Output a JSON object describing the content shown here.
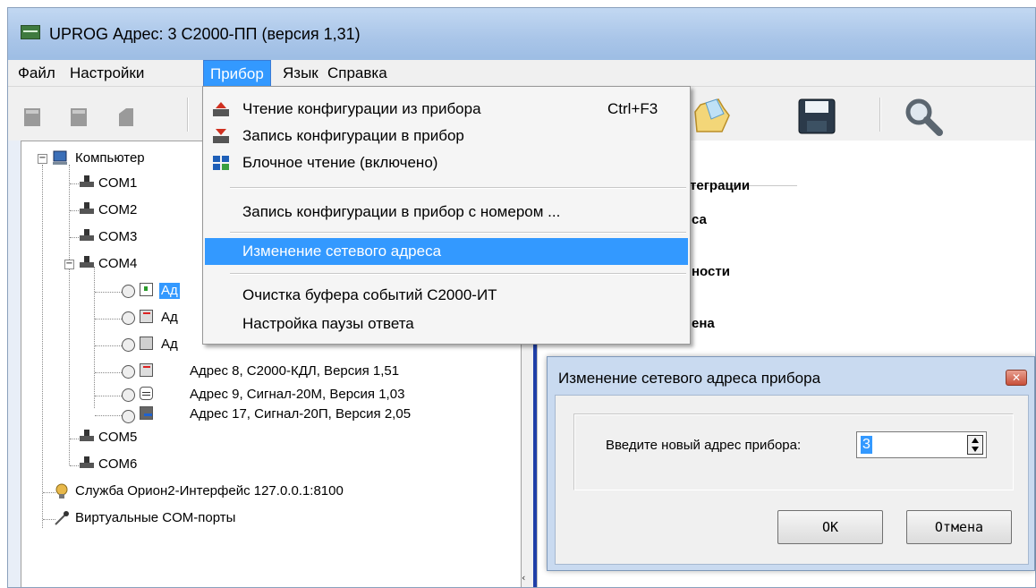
{
  "window": {
    "title": "UPROG  Адрес:  3  С2000-ПП (версия  1,31)",
    "icon": "app-icon"
  },
  "menubar": {
    "items": [
      "Файл",
      "Настройки",
      "Прибор",
      "Язык",
      "Справка"
    ],
    "open_item": "Прибор"
  },
  "toolbar": {
    "icons": [
      "open-folder-icon",
      "save-disk-icon",
      "search-magnifier-icon"
    ]
  },
  "dropdown": {
    "items": [
      {
        "label": "Чтение конфигурации из прибора",
        "shortcut": "Ctrl+F3",
        "icon": "read-config-icon"
      },
      {
        "label": "Запись конфигурации в прибор",
        "shortcut": "",
        "icon": "write-config-icon"
      },
      {
        "label": "Блочное чтение (включено)",
        "shortcut": "",
        "icon": "block-read-icon"
      },
      {
        "label": "Запись конфигурации в прибор с номером ...",
        "shortcut": ""
      },
      {
        "label": "Изменение сетевого адреса",
        "shortcut": "",
        "highlighted": true
      },
      {
        "label": "Очистка буфера событий С2000-ИТ",
        "shortcut": ""
      },
      {
        "label": "Настройка паузы ответа",
        "shortcut": ""
      }
    ]
  },
  "tree": {
    "root": "Компьютер",
    "ports": [
      "COM1",
      "COM2",
      "COM3",
      "COM4",
      "COM5",
      "COM6"
    ],
    "devices": [
      {
        "label": "Ад",
        "selected": true
      },
      {
        "label": "Ад"
      },
      {
        "label": "Ад"
      },
      {
        "label": "Адрес 8, С2000-КДЛ, Версия 1,51"
      },
      {
        "label": "Адрес 9, Сигнал-20М, Версия 1,03"
      },
      {
        "label": "Адрес 17, Сигнал-20П, Версия 2,05"
      }
    ],
    "service": "Служба Орион2-Интерфейс 127.0.0.1:8100",
    "virtual": "Виртуальные COM-порты"
  },
  "right_panel": {
    "lines": [
      "теграции",
      "са",
      "ности",
      "ена"
    ]
  },
  "dialog": {
    "title": "Изменение сетевого адреса прибора",
    "prompt": "Введите новый адрес прибора:",
    "value": "3",
    "ok": "OK",
    "cancel": "Отмена"
  },
  "colors": {
    "highlight": "#3399ff",
    "splitter_accent": "#1f3fa8"
  }
}
